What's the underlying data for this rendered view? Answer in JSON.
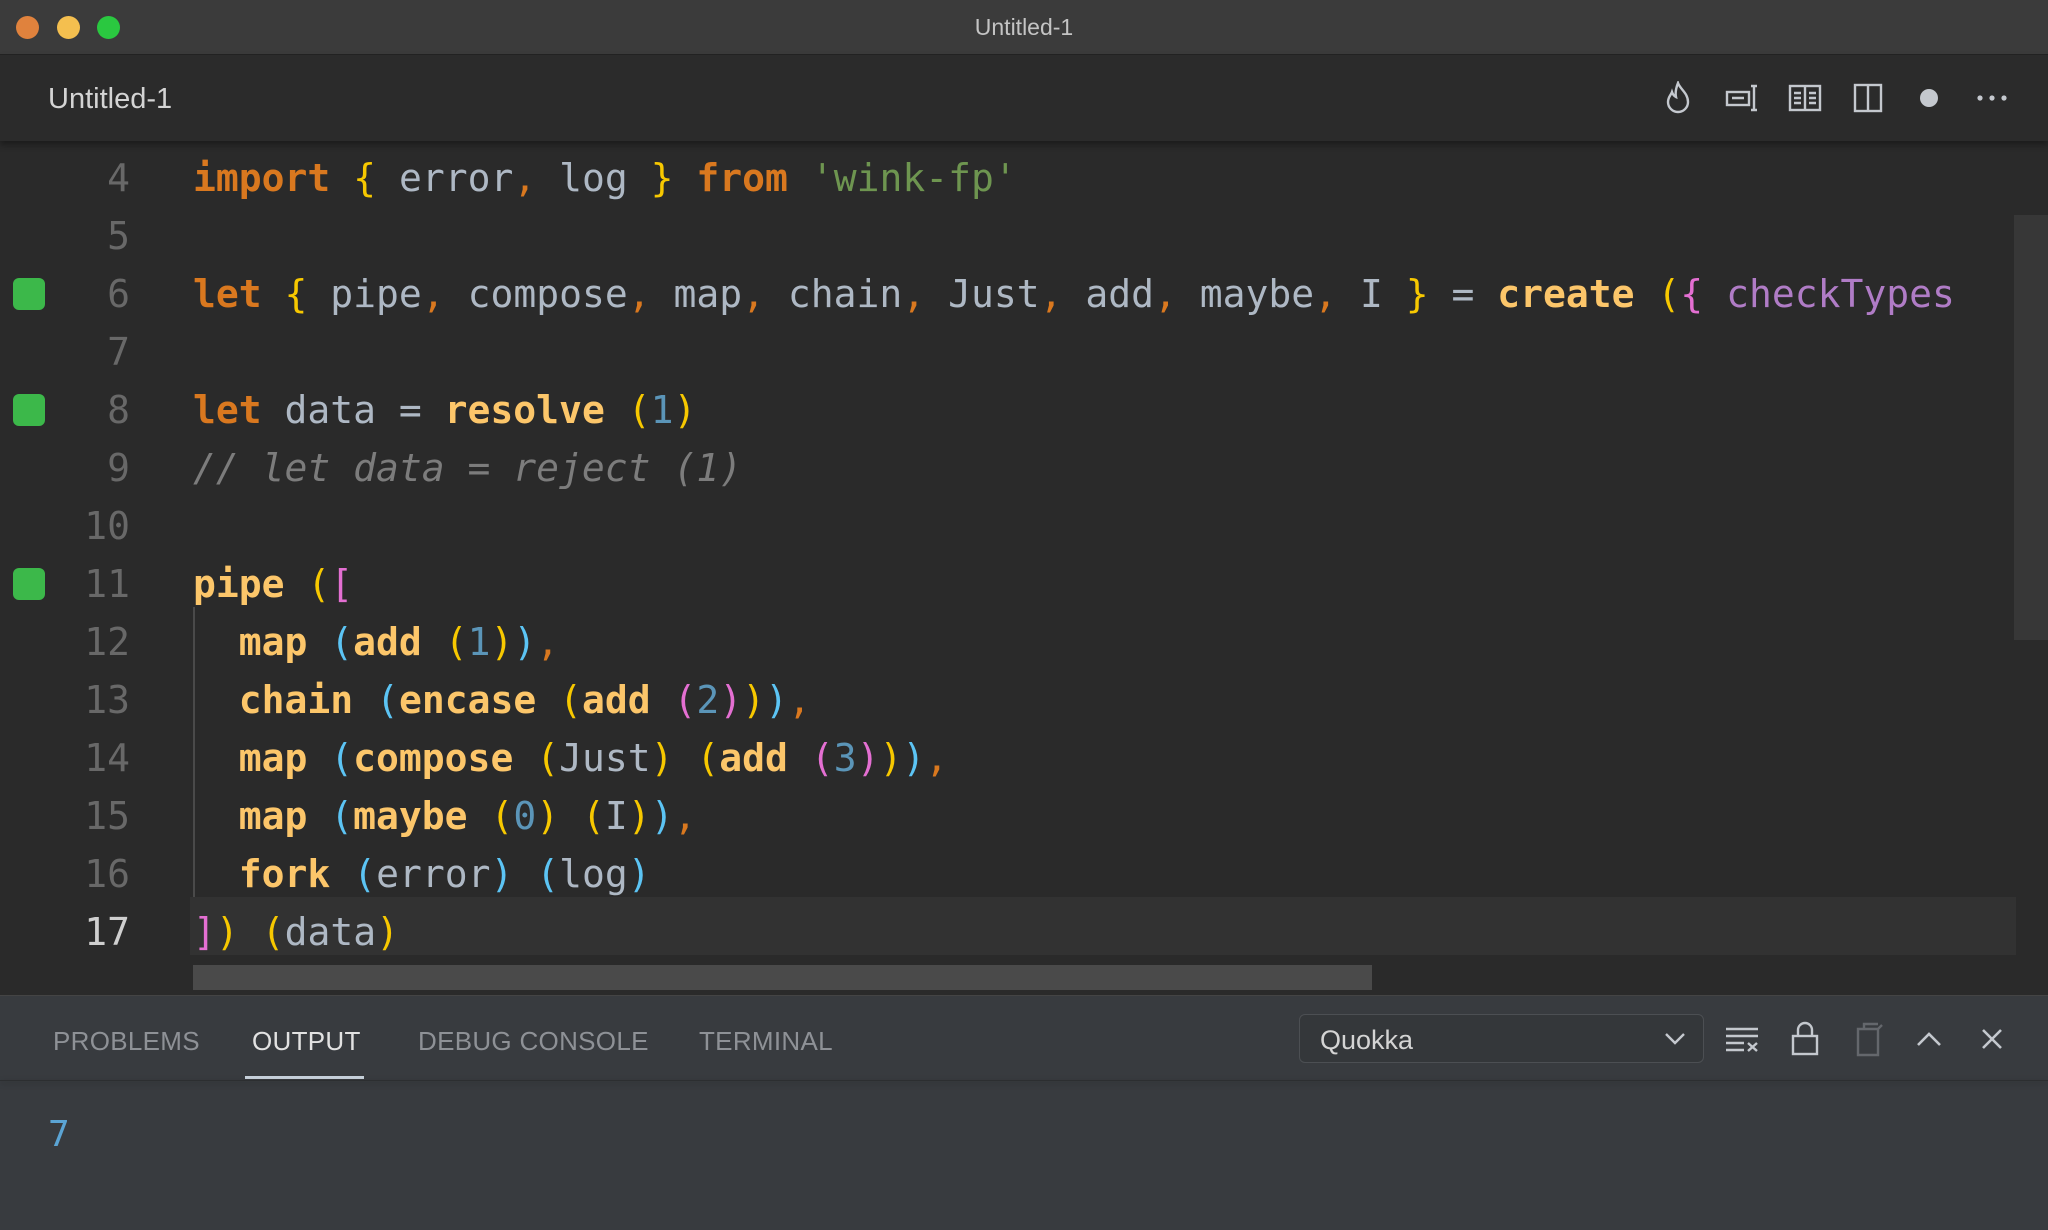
{
  "window": {
    "title": "Untitled-1",
    "traffic_lights": {
      "close": "#e0823d",
      "minimize": "#f4bf4f",
      "maximize": "#2ac840"
    }
  },
  "tab": {
    "title": "Untitled-1",
    "actions": [
      "quokka-flame-icon",
      "run-debug-icon",
      "open-preview-icon",
      "split-editor-icon",
      "unsaved-dot-icon",
      "more-actions-icon"
    ]
  },
  "editor": {
    "current_line": 17,
    "lines": [
      {
        "n": "4",
        "marker": false,
        "tokens": [
          [
            "import",
            "kw"
          ],
          [
            " ",
            "id"
          ],
          [
            "{",
            "b1"
          ],
          [
            " error",
            "id"
          ],
          [
            ",",
            "pu"
          ],
          [
            " log ",
            "id"
          ],
          [
            "}",
            "b1"
          ],
          [
            " ",
            "id"
          ],
          [
            "from",
            "kw"
          ],
          [
            " ",
            "id"
          ],
          [
            "'wink-fp'",
            "str"
          ]
        ]
      },
      {
        "n": "5",
        "marker": false,
        "tokens": []
      },
      {
        "n": "6",
        "marker": true,
        "tokens": [
          [
            "let",
            "kw"
          ],
          [
            " ",
            "id"
          ],
          [
            "{",
            "b1"
          ],
          [
            " pipe",
            "id"
          ],
          [
            ",",
            "pu"
          ],
          [
            " compose",
            "id"
          ],
          [
            ",",
            "pu"
          ],
          [
            " map",
            "id"
          ],
          [
            ",",
            "pu"
          ],
          [
            " chain",
            "id"
          ],
          [
            ",",
            "pu"
          ],
          [
            " Just",
            "id"
          ],
          [
            ",",
            "pu"
          ],
          [
            " add",
            "id"
          ],
          [
            ",",
            "pu"
          ],
          [
            " maybe",
            "id"
          ],
          [
            ",",
            "pu"
          ],
          [
            " I ",
            "id"
          ],
          [
            "}",
            "b1"
          ],
          [
            " = ",
            "id"
          ],
          [
            "create",
            "fn"
          ],
          [
            " ",
            "id"
          ],
          [
            "(",
            "b1"
          ],
          [
            "{",
            "b2"
          ],
          [
            " checkTypes",
            "pr"
          ]
        ]
      },
      {
        "n": "7",
        "marker": false,
        "tokens": []
      },
      {
        "n": "8",
        "marker": true,
        "tokens": [
          [
            "let",
            "kw"
          ],
          [
            " data = ",
            "id"
          ],
          [
            "resolve",
            "fn"
          ],
          [
            " ",
            "id"
          ],
          [
            "(",
            "b1"
          ],
          [
            "1",
            "num"
          ],
          [
            ")",
            "b1"
          ]
        ]
      },
      {
        "n": "9",
        "marker": false,
        "tokens": [
          [
            "// let data = reject (1)",
            "cm"
          ]
        ]
      },
      {
        "n": "10",
        "marker": false,
        "tokens": []
      },
      {
        "n": "11",
        "marker": true,
        "tokens": [
          [
            "pipe",
            "fn"
          ],
          [
            " ",
            "id"
          ],
          [
            "(",
            "b1"
          ],
          [
            "[",
            "b2"
          ]
        ]
      },
      {
        "n": "12",
        "marker": false,
        "tokens": [
          [
            "  map",
            "fn"
          ],
          [
            " ",
            "id"
          ],
          [
            "(",
            "b3"
          ],
          [
            "add",
            "fn"
          ],
          [
            " ",
            "id"
          ],
          [
            "(",
            "b1"
          ],
          [
            "1",
            "num"
          ],
          [
            ")",
            "b1"
          ],
          [
            ")",
            "b3"
          ],
          [
            ",",
            "pu"
          ]
        ]
      },
      {
        "n": "13",
        "marker": false,
        "tokens": [
          [
            "  chain",
            "fn"
          ],
          [
            " ",
            "id"
          ],
          [
            "(",
            "b3"
          ],
          [
            "encase",
            "fn"
          ],
          [
            " ",
            "id"
          ],
          [
            "(",
            "b1"
          ],
          [
            "add",
            "fn"
          ],
          [
            " ",
            "id"
          ],
          [
            "(",
            "b2"
          ],
          [
            "2",
            "num"
          ],
          [
            ")",
            "b2"
          ],
          [
            ")",
            "b1"
          ],
          [
            ")",
            "b3"
          ],
          [
            ",",
            "pu"
          ]
        ]
      },
      {
        "n": "14",
        "marker": false,
        "tokens": [
          [
            "  map",
            "fn"
          ],
          [
            " ",
            "id"
          ],
          [
            "(",
            "b3"
          ],
          [
            "compose",
            "fn"
          ],
          [
            " ",
            "id"
          ],
          [
            "(",
            "b1"
          ],
          [
            "Just",
            "id"
          ],
          [
            ")",
            "b1"
          ],
          [
            " ",
            "id"
          ],
          [
            "(",
            "b1"
          ],
          [
            "add",
            "fn"
          ],
          [
            " ",
            "id"
          ],
          [
            "(",
            "b2"
          ],
          [
            "3",
            "num"
          ],
          [
            ")",
            "b2"
          ],
          [
            ")",
            "b1"
          ],
          [
            ")",
            "b3"
          ],
          [
            ",",
            "pu"
          ]
        ]
      },
      {
        "n": "15",
        "marker": false,
        "tokens": [
          [
            "  map",
            "fn"
          ],
          [
            " ",
            "id"
          ],
          [
            "(",
            "b3"
          ],
          [
            "maybe",
            "fn"
          ],
          [
            " ",
            "id"
          ],
          [
            "(",
            "b1"
          ],
          [
            "0",
            "num"
          ],
          [
            ")",
            "b1"
          ],
          [
            " ",
            "id"
          ],
          [
            "(",
            "b1"
          ],
          [
            "I",
            "id"
          ],
          [
            ")",
            "b1"
          ],
          [
            ")",
            "b3"
          ],
          [
            ",",
            "pu"
          ]
        ]
      },
      {
        "n": "16",
        "marker": false,
        "tokens": [
          [
            "  fork",
            "fn"
          ],
          [
            " ",
            "id"
          ],
          [
            "(",
            "b3"
          ],
          [
            "error",
            "id"
          ],
          [
            ")",
            "b3"
          ],
          [
            " ",
            "id"
          ],
          [
            "(",
            "b3"
          ],
          [
            "log",
            "id"
          ],
          [
            ")",
            "b3"
          ]
        ]
      },
      {
        "n": "17",
        "marker": false,
        "tokens": [
          [
            "]",
            "b2"
          ],
          [
            ")",
            "b1"
          ],
          [
            " ",
            "id"
          ],
          [
            "(",
            "b1"
          ],
          [
            "data",
            "id"
          ],
          [
            ")",
            "b1"
          ]
        ]
      }
    ]
  },
  "panel": {
    "tabs": [
      {
        "label": "PROBLEMS"
      },
      {
        "label": "OUTPUT",
        "active": true
      },
      {
        "label": "DEBUG CONSOLE"
      },
      {
        "label": "TERMINAL"
      }
    ],
    "output_channel": "Quokka",
    "actions": [
      "clear-output-icon",
      "lock-scroll-icon",
      "open-log-icon",
      "maximize-panel-icon",
      "close-panel-icon"
    ],
    "output": "7"
  }
}
